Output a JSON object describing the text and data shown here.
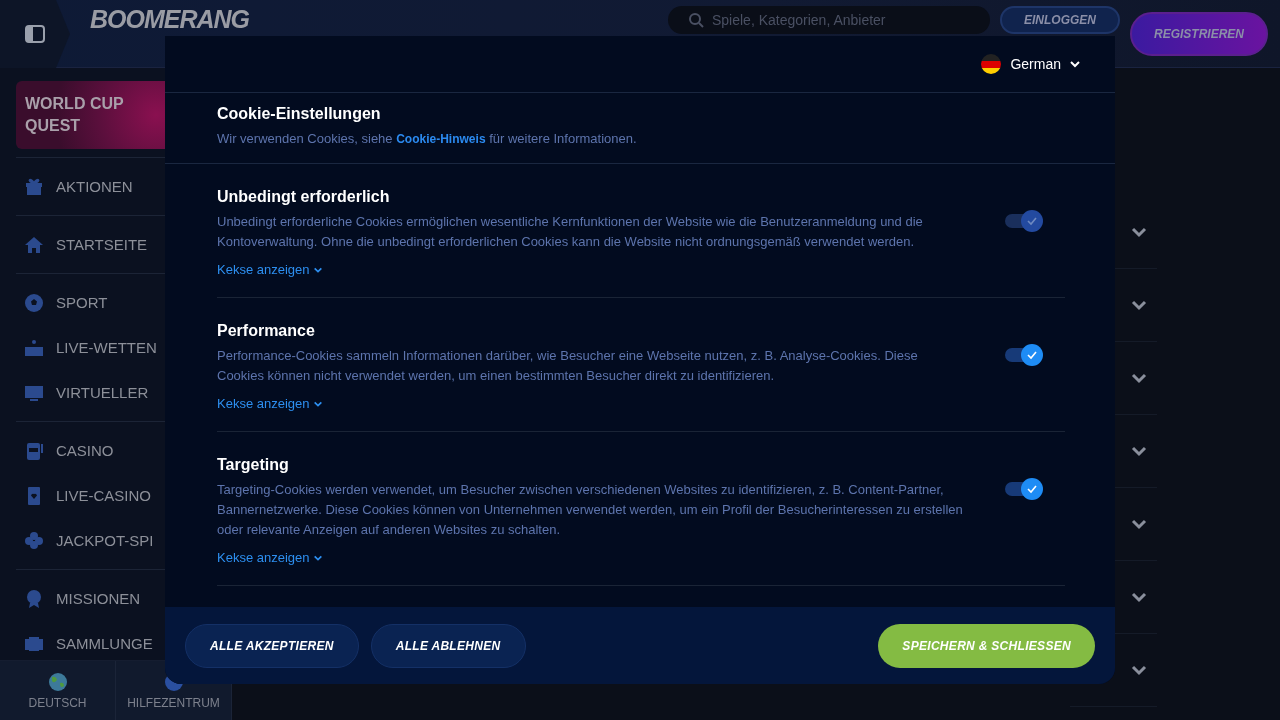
{
  "header": {
    "logo": "BOOMERANG",
    "search": {
      "placeholder": "Spiele, Kategorien, Anbieter"
    },
    "buttons": [
      "EINLOGGEN",
      "REGISTRIEREN"
    ]
  },
  "sidebar": {
    "promo": "WORLD CUP QUEST",
    "groups": [
      [
        "AKTIONEN"
      ],
      [
        "STARTSEITE"
      ],
      [
        "SPORT",
        "LIVE-WETTEN",
        "VIRTUELLER"
      ],
      [
        "CASINO",
        "LIVE-CASINO",
        "JACKPOT-SPI"
      ],
      [
        "MISSIONEN",
        "SAMMLUNGE"
      ]
    ],
    "footer": [
      "DEUTSCH",
      "HILFEZENTRUM"
    ]
  },
  "cookie_dialog": {
    "language": "German",
    "title": "Cookie-Einstellungen",
    "intro": "Wir verwenden Cookies, siehe **Cookie-Hinweis** für weitere Informationen.",
    "categories": [
      {
        "title": "Unbedingt erforderlich",
        "text": "Unbedingt erforderliche Cookies ermöglichen wesentliche Kernfunktionen der Website wie die Benutzeranmeldung und die Kontoverwaltung. Ohne die unbedingt erforderlichen Cookies kann die Website nicht ordnungsgemäß verwendet werden.",
        "link": "Kekse anzeigen",
        "checked": true,
        "disabled": true
      },
      {
        "title": "Performance",
        "text": "Performance-Cookies sammeln Informationen darüber, wie Besucher eine Webseite nutzen, z. B. Analyse-Cookies. Diese Cookies können nicht verwendet werden, um einen bestimmten Besucher direkt zu identifizieren.",
        "link": "Kekse anzeigen",
        "checked": true,
        "disabled": false
      },
      {
        "title": "Targeting",
        "text": "Targeting-Cookies werden verwendet, um Besucher zwischen verschiedenen Websites zu identifizieren, z. B. Content-Partner, Bannernetzwerke. Diese Cookies können von Unternehmen verwendet werden, um ein Profil der Besucherinteressen zu erstellen oder relevante Anzeigen auf anderen Websites zu schalten.",
        "link": "Kekse anzeigen",
        "checked": true,
        "disabled": false
      }
    ],
    "buttons": [
      {
        "kind": "secondary",
        "label": "ALLE AKZEPTIEREN"
      },
      {
        "kind": "secondary",
        "label": "ALLE ABLEHNEN"
      },
      {
        "kind": "primary",
        "label": "SPEICHERN & SCHLIESSEN"
      }
    ]
  }
}
